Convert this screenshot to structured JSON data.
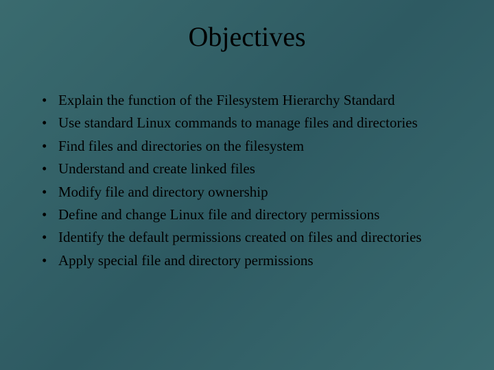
{
  "slide": {
    "title": "Objectives",
    "bullets": [
      "Explain the function of the Filesystem Hierarchy Standard",
      "Use standard Linux commands to manage files and directories",
      "Find files and directories on the filesystem",
      "Understand and create linked files",
      "Modify file and directory ownership",
      "Define and change Linux file and directory permissions",
      "Identify the default permissions created on files and directories",
      "Apply special file and directory permissions"
    ]
  }
}
